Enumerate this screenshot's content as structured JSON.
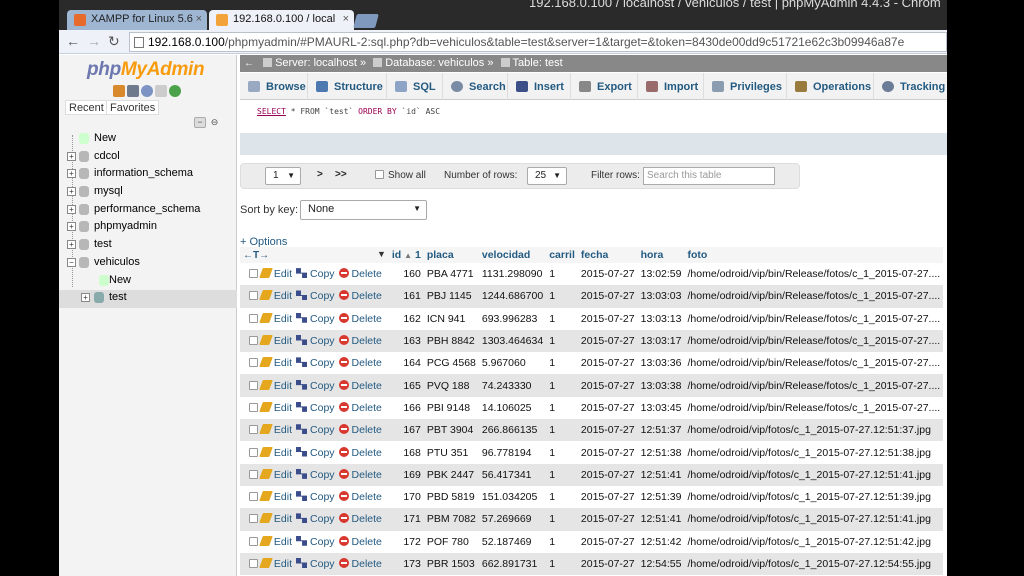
{
  "browser": {
    "window_title": "192.168.0.100 / localhost / vehiculos / test | phpMyAdmin 4.4.3 - Chrom",
    "tabs": [
      {
        "label": "XAMPP for Linux 5.6"
      },
      {
        "label": "192.168.0.100 / local"
      }
    ],
    "url_host": "192.168.0.100",
    "url_rest": "/phpmyadmin/#PMAURL-2:sql.php?db=vehiculos&table=test&server=1&target=&token=8430de00dd9c51721e62c3b09946a87e"
  },
  "sidebar": {
    "logo_php": "php",
    "logo_ma": "MyAdmin",
    "recent_label": "Recent",
    "favorites_label": "Favorites",
    "tree": [
      {
        "label": "New",
        "level": 0,
        "expander": ""
      },
      {
        "label": "cdcol",
        "level": 0,
        "expander": "+"
      },
      {
        "label": "information_schema",
        "level": 0,
        "expander": "+"
      },
      {
        "label": "mysql",
        "level": 0,
        "expander": "+"
      },
      {
        "label": "performance_schema",
        "level": 0,
        "expander": "+"
      },
      {
        "label": "phpmyadmin",
        "level": 0,
        "expander": "+"
      },
      {
        "label": "test",
        "level": 0,
        "expander": "+"
      },
      {
        "label": "vehiculos",
        "level": 0,
        "expander": "−"
      },
      {
        "label": "New",
        "level": 1,
        "expander": ""
      },
      {
        "label": "test",
        "level": 1,
        "expander": "+"
      }
    ]
  },
  "breadcrumb": {
    "server": "Server: localhost »",
    "database": "Database: vehiculos »",
    "table": "Table: test"
  },
  "tabs": [
    {
      "label": "Browse"
    },
    {
      "label": "Structure"
    },
    {
      "label": "SQL"
    },
    {
      "label": "Search"
    },
    {
      "label": "Insert"
    },
    {
      "label": "Export"
    },
    {
      "label": "Import"
    },
    {
      "label": "Privileges"
    },
    {
      "label": "Operations"
    },
    {
      "label": "Tracking"
    }
  ],
  "sql": {
    "select": "SELECT",
    "body": " * FROM `test` ",
    "order": "ORDER BY",
    "tail": " `id` ASC"
  },
  "navigation": {
    "page_value": "1",
    "next_label": ">",
    "last_label": ">>",
    "show_all_label": "Show all",
    "rows_label": "Number of rows:",
    "rows_value": "25",
    "filter_label": "Filter rows:",
    "filter_placeholder": "Search this table"
  },
  "sort": {
    "label": "Sort by key:",
    "value": "None"
  },
  "options_label": "+ Options",
  "table": {
    "headers": {
      "id": "id",
      "sort_rank": "1",
      "placa": "placa",
      "velocidad": "velocidad",
      "carril": "carril",
      "fecha": "fecha",
      "hora": "hora",
      "foto": "foto"
    },
    "actions": {
      "edit": "Edit",
      "copy": "Copy",
      "delete": "Delete"
    },
    "rows": [
      {
        "id": "160",
        "placa": "PBA 4771",
        "velocidad": "1131.298090",
        "carril": "1",
        "fecha": "2015-07-27",
        "hora": "13:02:59",
        "foto": "/home/odroid/vip/bin/Release/fotos/c_1_2015-07-27...."
      },
      {
        "id": "161",
        "placa": "PBJ 1145",
        "velocidad": "1244.686700",
        "carril": "1",
        "fecha": "2015-07-27",
        "hora": "13:03:03",
        "foto": "/home/odroid/vip/bin/Release/fotos/c_1_2015-07-27...."
      },
      {
        "id": "162",
        "placa": "ICN 941",
        "velocidad": "693.996283",
        "carril": "1",
        "fecha": "2015-07-27",
        "hora": "13:03:13",
        "foto": "/home/odroid/vip/bin/Release/fotos/c_1_2015-07-27...."
      },
      {
        "id": "163",
        "placa": "PBH 8842",
        "velocidad": "1303.464634",
        "carril": "1",
        "fecha": "2015-07-27",
        "hora": "13:03:17",
        "foto": "/home/odroid/vip/bin/Release/fotos/c_1_2015-07-27...."
      },
      {
        "id": "164",
        "placa": "PCG 4568",
        "velocidad": "5.967060",
        "carril": "1",
        "fecha": "2015-07-27",
        "hora": "13:03:36",
        "foto": "/home/odroid/vip/bin/Release/fotos/c_1_2015-07-27...."
      },
      {
        "id": "165",
        "placa": "PVQ 188",
        "velocidad": "74.243330",
        "carril": "1",
        "fecha": "2015-07-27",
        "hora": "13:03:38",
        "foto": "/home/odroid/vip/bin/Release/fotos/c_1_2015-07-27...."
      },
      {
        "id": "166",
        "placa": "PBI 9148",
        "velocidad": "14.106025",
        "carril": "1",
        "fecha": "2015-07-27",
        "hora": "13:03:45",
        "foto": "/home/odroid/vip/bin/Release/fotos/c_1_2015-07-27...."
      },
      {
        "id": "167",
        "placa": "PBT 3904",
        "velocidad": "266.866135",
        "carril": "1",
        "fecha": "2015-07-27",
        "hora": "12:51:37",
        "foto": "/home/odroid/vip/fotos/c_1_2015-07-27.12:51:37.jpg"
      },
      {
        "id": "168",
        "placa": "PTU 351",
        "velocidad": "96.778194",
        "carril": "1",
        "fecha": "2015-07-27",
        "hora": "12:51:38",
        "foto": "/home/odroid/vip/fotos/c_1_2015-07-27.12:51:38.jpg"
      },
      {
        "id": "169",
        "placa": "PBK 2447",
        "velocidad": "56.417341",
        "carril": "1",
        "fecha": "2015-07-27",
        "hora": "12:51:41",
        "foto": "/home/odroid/vip/fotos/c_1_2015-07-27.12:51:41.jpg"
      },
      {
        "id": "170",
        "placa": "PBD 5819",
        "velocidad": "151.034205",
        "carril": "1",
        "fecha": "2015-07-27",
        "hora": "12:51:39",
        "foto": "/home/odroid/vip/fotos/c_1_2015-07-27.12:51:39.jpg"
      },
      {
        "id": "171",
        "placa": "PBM 7082",
        "velocidad": "57.269669",
        "carril": "1",
        "fecha": "2015-07-27",
        "hora": "12:51:41",
        "foto": "/home/odroid/vip/fotos/c_1_2015-07-27.12:51:41.jpg"
      },
      {
        "id": "172",
        "placa": "POF 780",
        "velocidad": "52.187469",
        "carril": "1",
        "fecha": "2015-07-27",
        "hora": "12:51:42",
        "foto": "/home/odroid/vip/fotos/c_1_2015-07-27.12:51:42.jpg"
      },
      {
        "id": "173",
        "placa": "PBR 1503",
        "velocidad": "662.891731",
        "carril": "1",
        "fecha": "2015-07-27",
        "hora": "12:54:55",
        "foto": "/home/odroid/vip/fotos/c_1_2015-07-27.12:54:55.jpg"
      }
    ]
  }
}
